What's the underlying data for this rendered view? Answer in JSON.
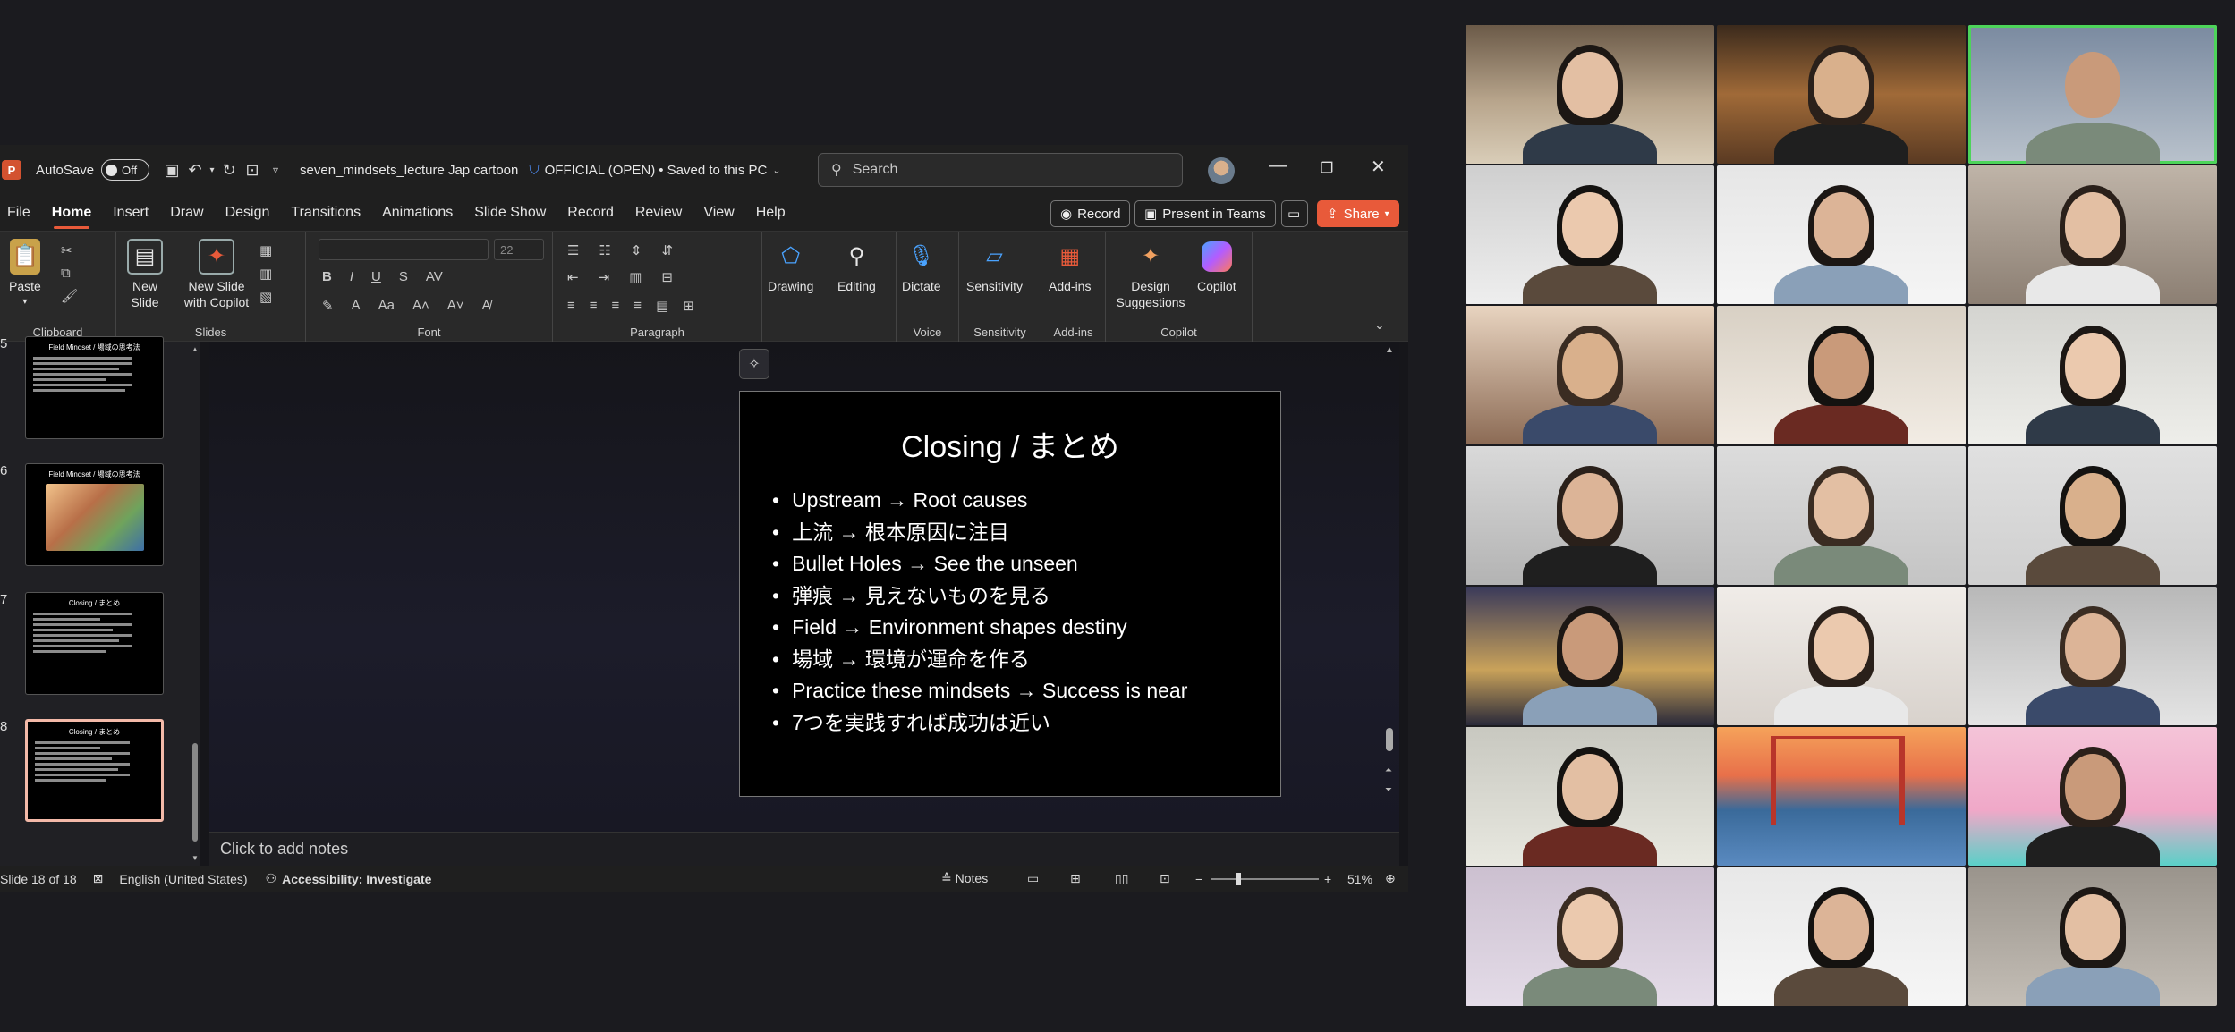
{
  "titlebar": {
    "autosave_label": "AutoSave",
    "autosave_state": "Off",
    "filename": "seven_mindsets_lecture Jap cartoon",
    "sensitivity": "OFFICIAL (OPEN)",
    "save_status": "• Saved to this PC",
    "search_placeholder": "Search"
  },
  "menu": [
    "File",
    "Home",
    "Insert",
    "Draw",
    "Design",
    "Transitions",
    "Animations",
    "Slide Show",
    "Record",
    "Review",
    "View",
    "Help"
  ],
  "menu_active": "Home",
  "actions": {
    "record": "Record",
    "present": "Present in Teams",
    "share": "Share"
  },
  "ribbon": {
    "clipboard": {
      "label": "Clipboard",
      "paste": "Paste"
    },
    "slides": {
      "label": "Slides",
      "new_slide": "New Slide",
      "new_slide_copilot": "New Slide with Copilot"
    },
    "font": {
      "label": "Font",
      "size": "22"
    },
    "paragraph": {
      "label": "Paragraph"
    },
    "drawing": "Drawing",
    "editing": "Editing",
    "voice": {
      "label": "Voice",
      "dictate": "Dictate"
    },
    "sensitivity": {
      "label": "Sensitivity",
      "button": "Sensitivity"
    },
    "addins": {
      "label": "Add-ins",
      "button": "Add-ins"
    },
    "copilot": {
      "label": "Copilot",
      "design": "Design Suggestions",
      "copilot": "Copilot"
    }
  },
  "thumbnails": [
    {
      "num": "5",
      "title": "Field Mindset / 場域の思考法"
    },
    {
      "num": "6",
      "title": "Field Mindset / 場域の思考法"
    },
    {
      "num": "7",
      "title": "Closing / まとめ"
    },
    {
      "num": "8",
      "title": "Closing / まとめ"
    }
  ],
  "slide": {
    "title": "Closing / まとめ",
    "bullets": [
      "Upstream → Root causes",
      "上流 → 根本原因に注目",
      "Bullet Holes → See the unseen",
      "弾痕 → 見えないものを見る",
      "Field → Environment shapes destiny",
      "場域 → 環境が運命を作る",
      "Practice these mindsets → Success is near",
      "7つを実践すれば成功は近い"
    ]
  },
  "notes_placeholder": "Click to add notes",
  "status": {
    "slide_count": "Slide 18 of 18",
    "language": "English (United States)",
    "accessibility": "Accessibility: Investigate",
    "notes": "Notes",
    "zoom": "51%"
  },
  "colors": {
    "accent": "#e85a3a",
    "speaking_border": "#4dd45a"
  }
}
